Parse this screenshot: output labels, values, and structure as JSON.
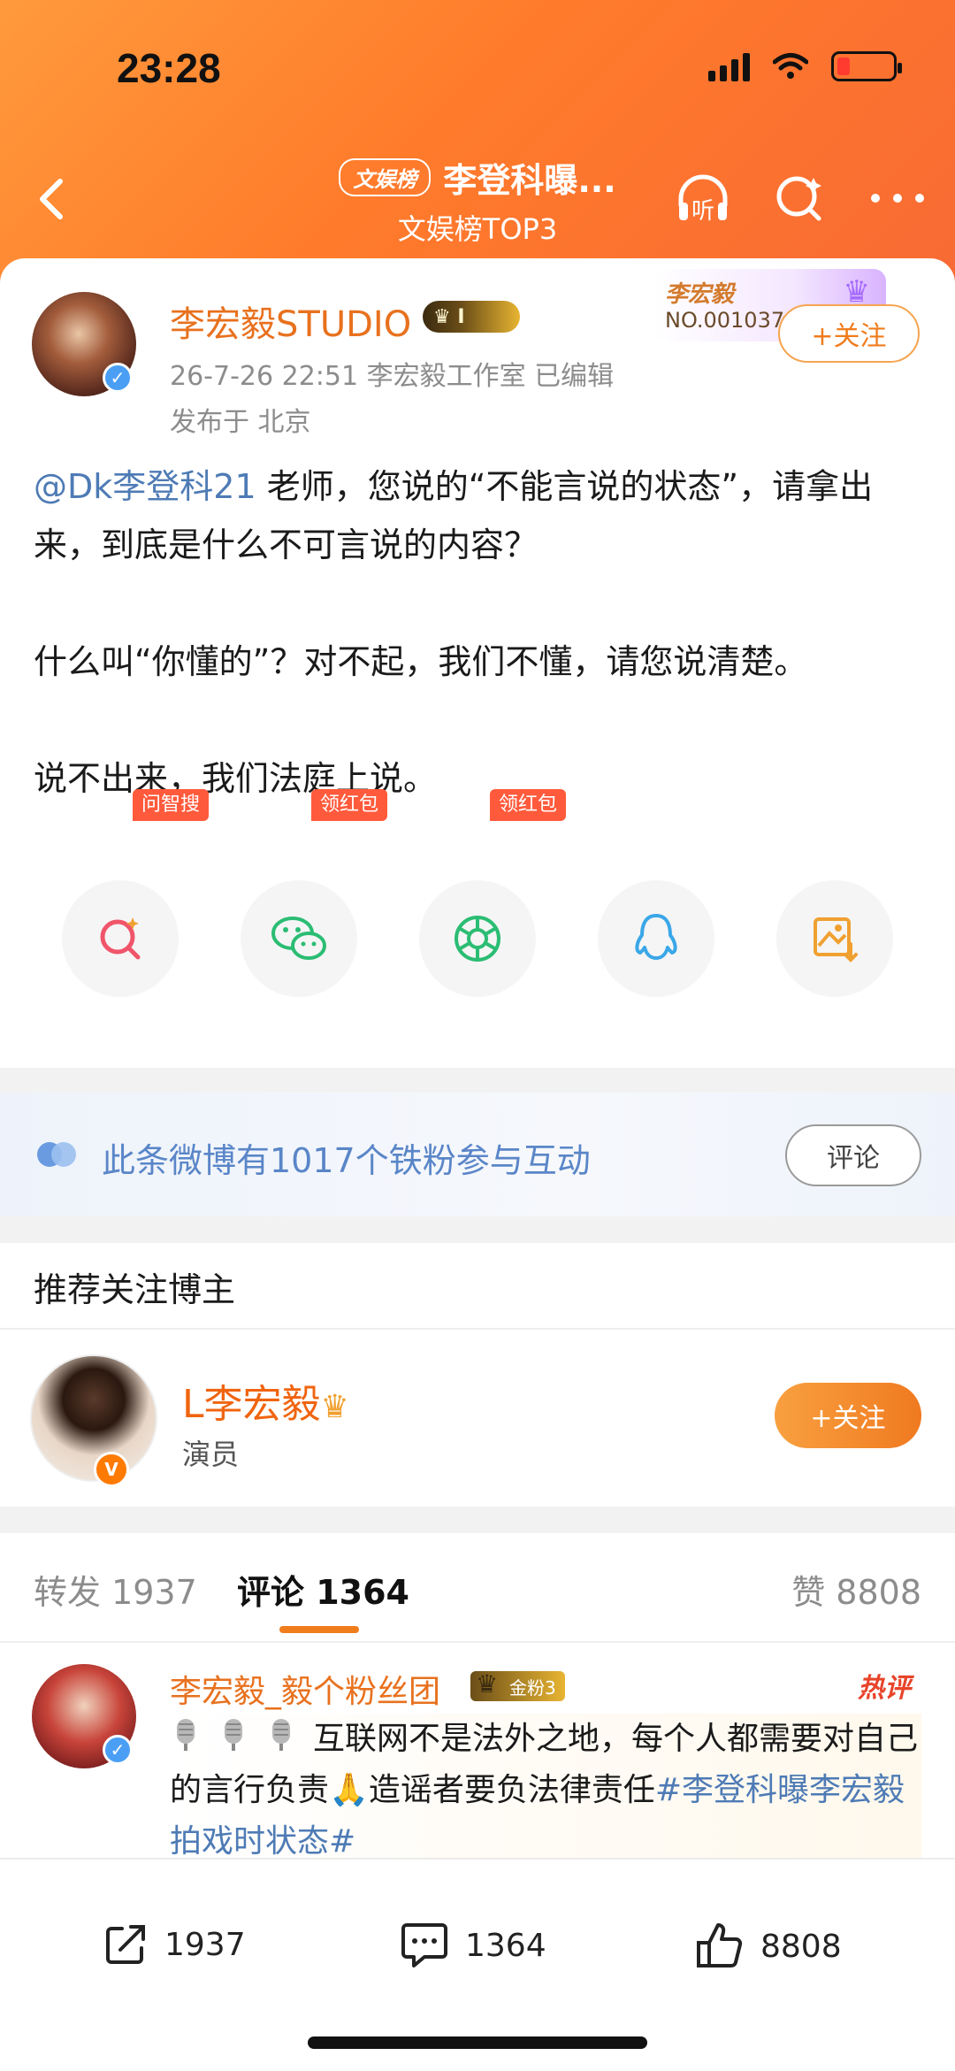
{
  "status_bar": {
    "time": "23:28"
  },
  "nav": {
    "tag": "文娱榜",
    "title": "李登科曝...",
    "subtitle": "文娱榜TOP3",
    "icons": [
      "back-icon",
      "headphone-icon",
      "search-icon",
      "more-icon"
    ],
    "headphone_label": "听"
  },
  "post": {
    "author": "李宏毅STUDIO",
    "vip_level": "I",
    "meta": "26-7-26 22:51  李宏毅工作室  已编辑",
    "location": "发布于 北京",
    "fan_card": {
      "name": "李宏毅",
      "number": "NO.001037"
    },
    "follow_label": "+关注",
    "mention": "@Dk李登科21",
    "text_line1_rest": " 老师，您说的“不能言说的状态”，请拿出来，到底是什么不可言说的内容？",
    "text_para2": "什么叫“你懂的”？对不起，我们不懂，请您说清楚。",
    "text_para3": "说不出来，我们法庭上说。"
  },
  "share": {
    "items": [
      {
        "icon": "ai-search-icon",
        "tag": "问智搜"
      },
      {
        "icon": "wechat-icon",
        "tag": "领红包"
      },
      {
        "icon": "moments-icon",
        "tag": "领红包"
      },
      {
        "icon": "qq-icon",
        "tag": ""
      },
      {
        "icon": "save-image-icon",
        "tag": ""
      }
    ]
  },
  "fans_bar": {
    "text": "此条微博有1017个铁粉参与互动",
    "button": "评论"
  },
  "recommend": {
    "title": "推荐关注博主",
    "name": "L李宏毅",
    "role": "演员",
    "follow_label": "+关注"
  },
  "tabs": {
    "repost": "转发 1937",
    "comments": "评论 1364",
    "likes": "赞 8808"
  },
  "comment": {
    "author": "李宏毅_毅个粉丝团",
    "badge": "金粉3",
    "hot": "热评",
    "text": "互联网不是法外之地，每个人都需要对自己的言行负责",
    "text2": "造谣者要负法律责任",
    "hashtag": "#李登科曝李宏毅拍戏时状态#"
  },
  "bottom_bar": {
    "repost": "1937",
    "comments": "1364",
    "likes": "8808"
  },
  "colors": {
    "header_orange": "#ff7b2b",
    "accent": "#f07c1c",
    "link_blue": "#4e7bb5"
  }
}
